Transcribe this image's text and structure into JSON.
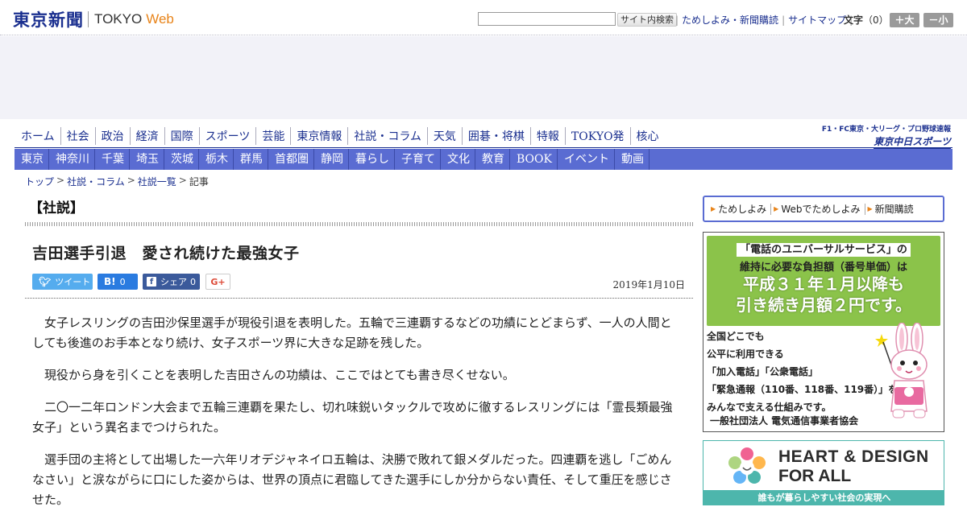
{
  "header": {
    "logo_jp": "東京新聞",
    "logo_en": "TOKYO",
    "logo_web": "Web",
    "search_button": "サイト内検索",
    "links": [
      "ためしよみ・新聞購読",
      "サイトマップ"
    ],
    "font_label": "文字",
    "font_value": "（0）",
    "font_bigger": "＋大",
    "font_smaller": "－小"
  },
  "nav_main": [
    "ホーム",
    "社会",
    "政治",
    "経済",
    "国際",
    "スポーツ",
    "芸能",
    "東京情報",
    "社説・コラム",
    "天気",
    "囲碁・将棋",
    "特報",
    "TOKYO発",
    "核心"
  ],
  "chunichi": {
    "line1": "F1・FC東京・大リーグ・プロ野球速報",
    "line2": "東京中日スポーツ"
  },
  "nav_region": [
    "東京",
    "神奈川",
    "千葉",
    "埼玉",
    "茨城",
    "栃木",
    "群馬",
    "首都圏",
    "静岡",
    "暮らし",
    "子育て",
    "文化",
    "教育",
    "BOOK",
    "イベント",
    "動画"
  ],
  "breadcrumb": [
    "トップ",
    "社説・コラム",
    "社説一覧",
    "記事"
  ],
  "article": {
    "kicker": "【社説】",
    "title": "吉田選手引退　愛され続けた最強女子",
    "date": "2019年1月10日",
    "share": {
      "tweet": "ツイート",
      "hatena_icon": "B!",
      "hatena_count": "0",
      "fb_label": "シェア",
      "fb_count": "0",
      "gplus": "G+"
    },
    "paragraphs": [
      "女子レスリングの吉田沙保里選手が現役引退を表明した。五輪で三連覇するなどの功績にとどまらず、一人の人間としても後進のお手本となり続け、女子スポーツ界に大きな足跡を残した。",
      "現役から身を引くことを表明した吉田さんの功績は、ここではとても書き尽くせない。",
      "二〇一二年ロンドン大会まで五輪三連覇を果たし、切れ味鋭いタックルで攻めに徹するレスリングには「霊長類最強女子」という異名までつけられた。",
      "選手団の主将として出場した一六年リオデジャネイロ五輪は、決勝で敗れて銀メダルだった。四連覇を逃し「ごめんなさい」と涙ながらに口にした姿からは、世界の頂点に君臨してきた選手にしか分からない責任、そして重圧を感じさせた。"
    ]
  },
  "sidebar": {
    "subscribe": [
      "ためしよみ",
      "Webでためしよみ",
      "新聞購読"
    ],
    "ad_universal": {
      "line1": "「電話のユニバーサルサービス」の",
      "line2": "維持に必要な負担額（番号単価）は",
      "line3": "平成３１年１月以降も",
      "line4": "引き続き月額２円です。",
      "body": [
        "全国どこでも",
        "公平に利用できる",
        "「加入電話」「公衆電話」",
        "「緊急通報（110番、118番、119番）」を",
        "みんなで支える仕組みです。"
      ],
      "org": "一般社団法人 電気通信事業者協会"
    },
    "ad_heart": {
      "line1": "HEART & DESIGN",
      "line2": "FOR ALL",
      "bar": "誰もが暮らしやすい社会の実現へ"
    }
  },
  "colors": {
    "brand_navy": "#1a2f8f",
    "nav_blue": "#5a6cd2",
    "accent_orange": "#e8841a",
    "ad_green": "#8bc34a",
    "ad_teal": "#4db6ac"
  }
}
